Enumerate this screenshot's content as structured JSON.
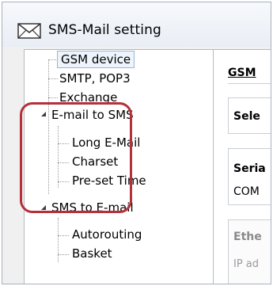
{
  "window": {
    "title": "SMS-Mail setting",
    "title_icon": "envelope-icon"
  },
  "tree": {
    "items": [
      {
        "label": "GSM device",
        "selected": true
      },
      {
        "label": "SMTP, POP3"
      },
      {
        "label": "Exchange"
      },
      {
        "label": "E-mail to SMS",
        "expanded": true
      },
      {
        "label": "Long E-Mail"
      },
      {
        "label": "Charset"
      },
      {
        "label": "Pre-set Time"
      },
      {
        "label": "SMS to E-mail",
        "expanded": true
      },
      {
        "label": "Autorouting"
      },
      {
        "label": "Basket"
      }
    ]
  },
  "right": {
    "header": "GSM",
    "select_label": "Sele",
    "serial_label": "Seria",
    "com_label": "COM",
    "ethernet_label": "Ethe",
    "ip_label": "IP ad"
  },
  "colors": {
    "highlight": "#b5303a",
    "selected_border": "#9bb5d6"
  }
}
